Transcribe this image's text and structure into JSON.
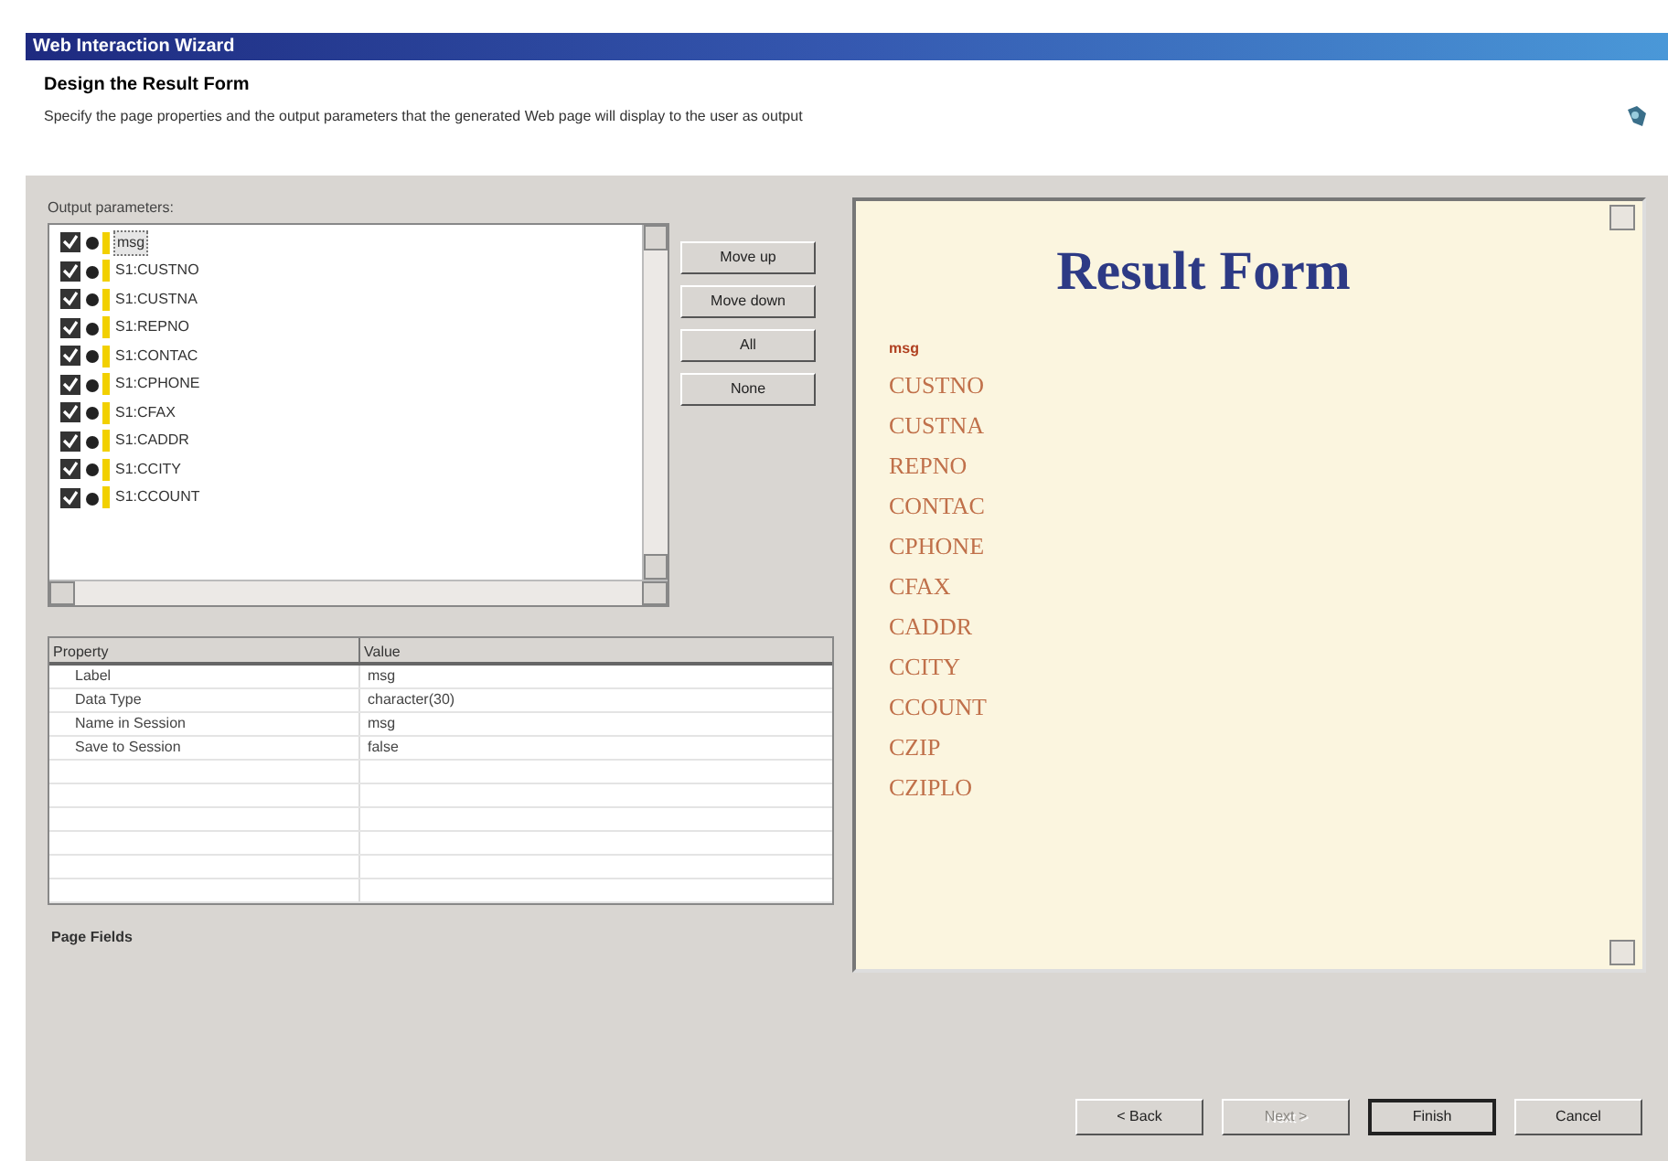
{
  "window": {
    "title": "Web Interaction Wizard"
  },
  "header": {
    "title": "Design the Result Form",
    "description": "Specify the page properties and the output parameters that the generated Web page will display to the user as output"
  },
  "output_parameters": {
    "label": "Output parameters:",
    "items": [
      {
        "label": "msg",
        "checked": true,
        "selected": true
      },
      {
        "label": "S1:CUSTNO",
        "checked": true,
        "selected": false
      },
      {
        "label": "S1:CUSTNA",
        "checked": true,
        "selected": false
      },
      {
        "label": "S1:REPNO",
        "checked": true,
        "selected": false
      },
      {
        "label": "S1:CONTAC",
        "checked": true,
        "selected": false
      },
      {
        "label": "S1:CPHONE",
        "checked": true,
        "selected": false
      },
      {
        "label": "S1:CFAX",
        "checked": true,
        "selected": false
      },
      {
        "label": "S1:CADDR",
        "checked": true,
        "selected": false
      },
      {
        "label": "S1:CCITY",
        "checked": true,
        "selected": false
      },
      {
        "label": "S1:CCOUNT",
        "checked": true,
        "selected": false
      }
    ]
  },
  "list_buttons": [
    "Move up",
    "Move down",
    "All",
    "None"
  ],
  "properties": {
    "columns": [
      "Property",
      "Value"
    ],
    "rows": [
      [
        "Label",
        "msg"
      ],
      [
        "Data Type",
        "character(30)"
      ],
      [
        "Name in Session",
        "msg"
      ],
      [
        "Save to Session",
        "false"
      ]
    ]
  },
  "page_tab": "Page Fields",
  "preview": {
    "title": "Result Form",
    "fields": [
      {
        "label": "msg",
        "kind": "small"
      },
      {
        "label": "CUSTNO",
        "kind": "field"
      },
      {
        "label": "CUSTNA",
        "kind": "field"
      },
      {
        "label": "REPNO",
        "kind": "field"
      },
      {
        "label": "CONTAC",
        "kind": "field"
      },
      {
        "label": "CPHONE",
        "kind": "field"
      },
      {
        "label": "CFAX",
        "kind": "field"
      },
      {
        "label": "CADDR",
        "kind": "field"
      },
      {
        "label": "CCITY",
        "kind": "field"
      },
      {
        "label": "CCOUNT",
        "kind": "field"
      },
      {
        "label": "CZIP",
        "kind": "field"
      },
      {
        "label": "CZIPLO",
        "kind": "field"
      }
    ]
  },
  "buttons": [
    {
      "label": "< Back",
      "disabled": false,
      "default": false
    },
    {
      "label": "Next >",
      "disabled": true,
      "default": false
    },
    {
      "label": "Finish",
      "disabled": false,
      "default": true
    },
    {
      "label": "Cancel",
      "disabled": false,
      "default": false
    }
  ]
}
